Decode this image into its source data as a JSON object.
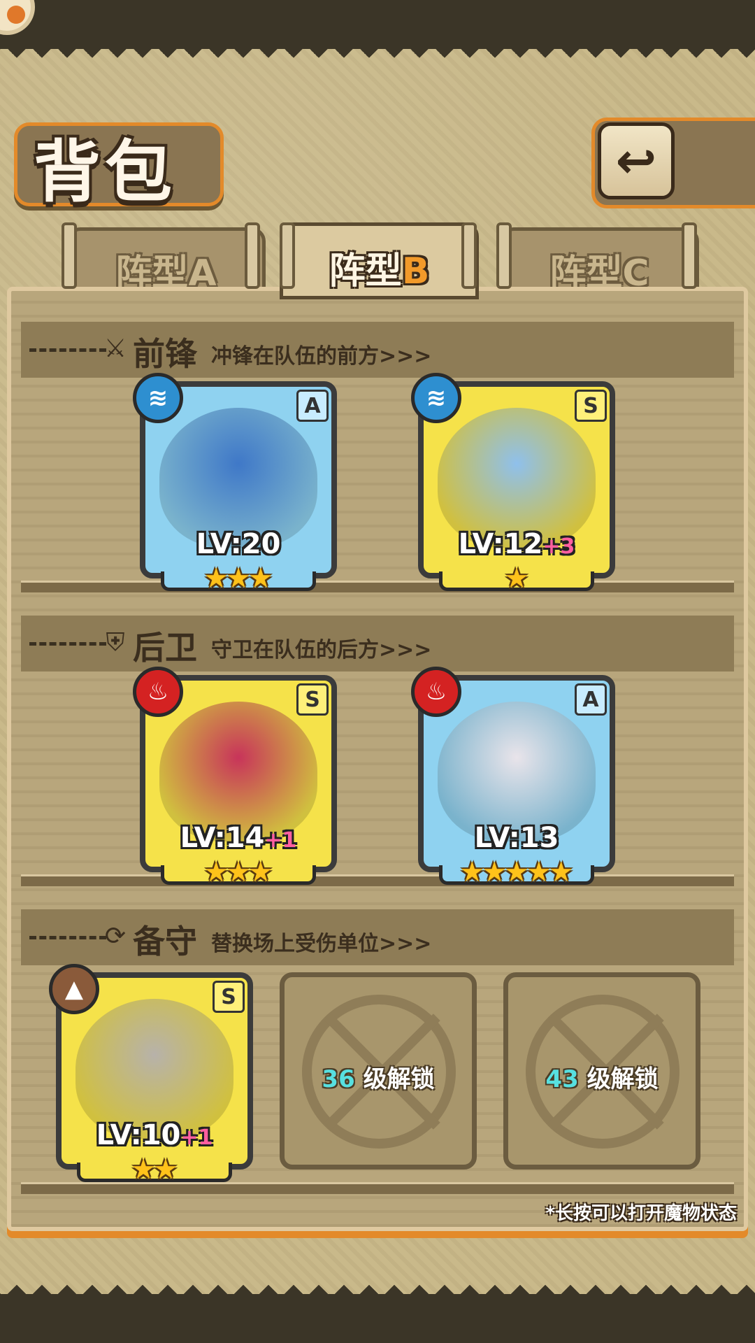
{
  "title": "背包",
  "back_icon": "return-arrow-icon",
  "tabs": [
    {
      "prefix": "阵型",
      "letter": "A",
      "active": false
    },
    {
      "prefix": "阵型",
      "letter": "B",
      "active": true
    },
    {
      "prefix": "阵型",
      "letter": "C",
      "active": false
    }
  ],
  "sections": {
    "front": {
      "title": "前锋",
      "subtitle": "冲锋在队伍的前方>>>",
      "icon": "sword-icon"
    },
    "back": {
      "title": "后卫",
      "subtitle": "守卫在队伍的后方>>>",
      "icon": "shield-icon"
    },
    "reserve": {
      "title": "备守",
      "subtitle": "替换场上受伤单位>>>",
      "icon": "swap-icon"
    }
  },
  "units": [
    {
      "slot": "front-1",
      "rank": "A",
      "element": "water",
      "level_label": "LV:20",
      "bonus": "",
      "stars": 3,
      "portrait_color": "#3f78c8"
    },
    {
      "slot": "front-2",
      "rank": "S",
      "element": "water",
      "level_label": "LV:12",
      "bonus": "+3",
      "stars": 1,
      "portrait_color": "#8fc0ec"
    },
    {
      "slot": "back-1",
      "rank": "S",
      "element": "fire",
      "level_label": "LV:14",
      "bonus": "+1",
      "stars": 3,
      "portrait_color": "#c8345a"
    },
    {
      "slot": "back-2",
      "rank": "A",
      "element": "fire",
      "level_label": "LV:13",
      "bonus": "",
      "stars": 5,
      "portrait_color": "#e9e4ea"
    },
    {
      "slot": "reserve-1",
      "rank": "S",
      "element": "earth",
      "level_label": "LV:10",
      "bonus": "+1",
      "stars": 2,
      "portrait_color": "#b7b2aa"
    }
  ],
  "locked_slots": [
    {
      "level": "36",
      "text": "级解锁"
    },
    {
      "level": "43",
      "text": "级解锁"
    }
  ],
  "colors": {
    "accent": "#e38a2a",
    "water": "#2e8fd0",
    "fire": "#d42222",
    "earth": "#8a5a3a",
    "rank_a": "#8fd2f0",
    "rank_s": "#f5e24a"
  },
  "hint": "*长按可以打开魔物状态"
}
